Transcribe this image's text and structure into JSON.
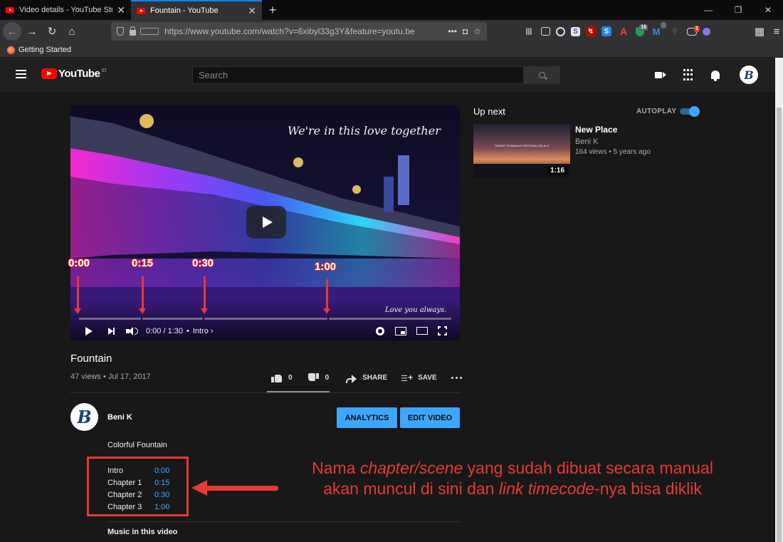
{
  "browser": {
    "tabs": [
      {
        "title": "Video details - YouTube Studio",
        "active": false
      },
      {
        "title": "Fountain - YouTube",
        "active": true
      }
    ],
    "url": "https://www.youtube.com/watch?v=6xibyl33g3Y&feature=youtu.be",
    "bookmark": "Getting Started",
    "toolbar_badges": [
      "16",
      "2",
      "1"
    ],
    "icons": [
      "back-arrow-icon",
      "forward-arrow-icon",
      "reload-icon",
      "home-icon",
      "shield-icon",
      "lock-icon",
      "more-dots-icon",
      "pocket-icon",
      "bookmark-star-icon",
      "library-icon",
      "sidebar-icon",
      "account-icon",
      "extension-icon",
      "pdf-icon",
      "stylus-icon",
      "adobe-icon",
      "menu-icon"
    ]
  },
  "youtube": {
    "logo_text": "YouTube",
    "region": "ID",
    "search_placeholder": "Search",
    "avatar_letter": "B"
  },
  "player": {
    "overlay_top": "We're in this love together",
    "overlay_bottom": "Love you always.",
    "time": "0:00 / 1:30",
    "dot": "•",
    "chapter": "Intro ›",
    "timestamp_labels": [
      "0:00",
      "0:15",
      "0:30",
      "1:00"
    ],
    "chapter_fractions": [
      0,
      0.1667,
      0.3333,
      0.6667
    ]
  },
  "video": {
    "title": "Fountain",
    "meta": "47 views • Jul 17, 2017",
    "likes": "0",
    "dislikes": "0",
    "share_label": "SHARE",
    "save_label": "SAVE"
  },
  "channel": {
    "name": "Beni K",
    "avatar_letter": "B",
    "analytics_label": "ANALYTICS",
    "edit_label": "EDIT VIDEO"
  },
  "description": {
    "text": "Colorful Fountain",
    "chapters": [
      {
        "name": "Intro",
        "time": "0:00"
      },
      {
        "name": "Chapter 1",
        "time": "0:15"
      },
      {
        "name": "Chapter 2",
        "time": "0:30"
      },
      {
        "name": "Chapter 3",
        "time": "1:00"
      }
    ],
    "music_heading": "Music in this video"
  },
  "annotation": {
    "line1_a": "Nama ",
    "line1_b": "chapter/scene",
    "line1_c": " yang sudah dibuat secara manual",
    "line2_a": "akan muncul di sini dan ",
    "line2_b": "link timecode",
    "line2_c": "-nya bisa diklik",
    "color": "#e53935"
  },
  "sidebar": {
    "up_next": "Up next",
    "autoplay": "AUTOPLAY",
    "autoplay_on": true,
    "recommendation": {
      "title": "New Place",
      "channel": "Beni K",
      "meta": "164 views • 5 years ago",
      "duration": "1:16",
      "thumb_caption": "TEMPAT DI MANA ATI BERTEMU SELALU"
    }
  },
  "colors": {
    "accent_blue": "#3ea6ff",
    "yt_red": "#ff0000",
    "page_bg": "#181818",
    "header_bg": "#202020"
  }
}
